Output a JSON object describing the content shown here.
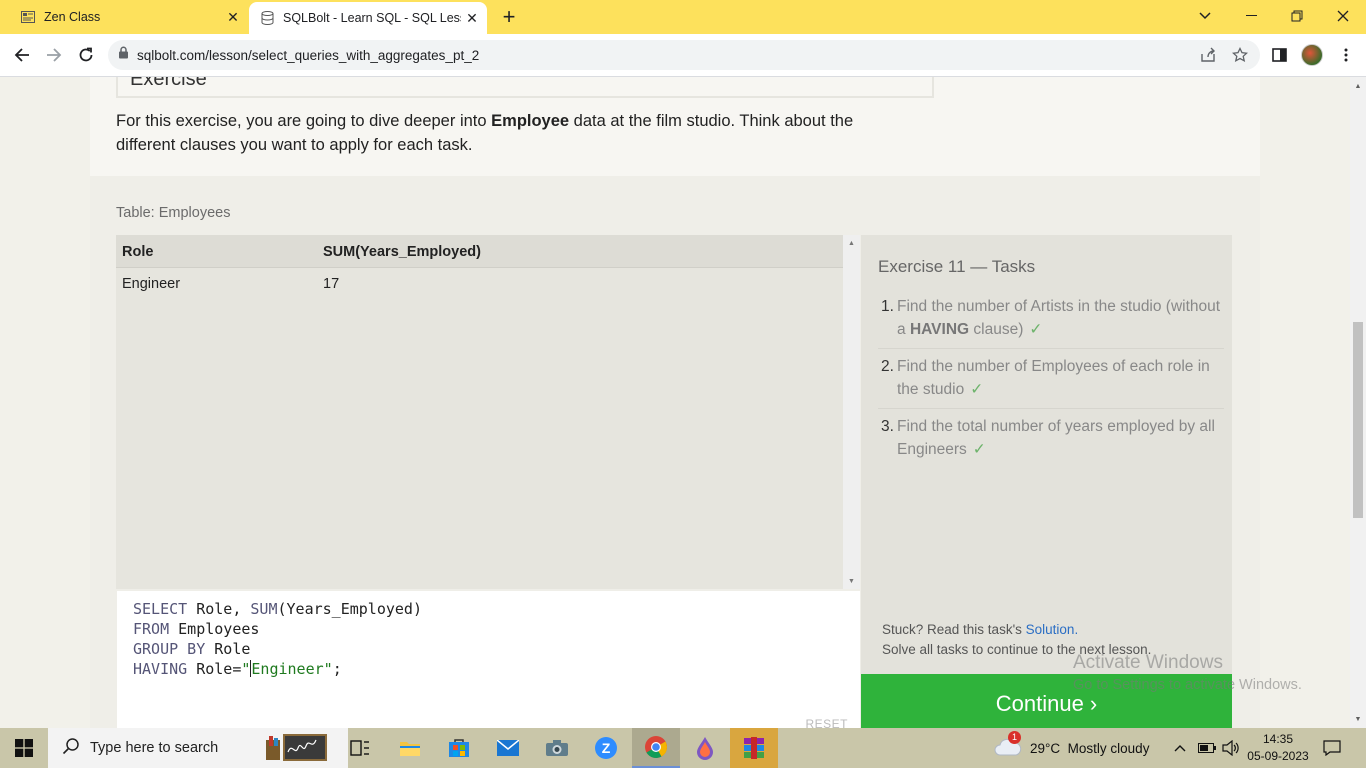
{
  "browser": {
    "tabs": [
      {
        "title": "Zen Class",
        "active": false,
        "icon": "zen-favicon"
      },
      {
        "title": "SQLBolt - Learn SQL - SQL Lesson",
        "active": true,
        "icon": "database-favicon"
      }
    ],
    "url": "sqlbolt.com/lesson/select_queries_with_aggregates_pt_2",
    "accent_color": "#fde15c"
  },
  "page": {
    "exercise_heading": "Exercise",
    "intro_before": "For this exercise, you are going to dive deeper into ",
    "intro_bold": "Employee",
    "intro_after": " data at the film studio. Think about the different clauses you want to apply for each task.",
    "table_caption": "Table: Employees",
    "results": {
      "columns": [
        "Role",
        "SUM(Years_Employed)"
      ],
      "rows": [
        [
          "Engineer",
          "17"
        ]
      ]
    },
    "query": {
      "line1_kw": "SELECT",
      "line1_rest_a": " Role, ",
      "line1_fn": "SUM",
      "line1_rest_b": "(Years_Employed)",
      "line2_kw": "FROM",
      "line2_rest": " Employees",
      "line3_kw": "GROUP BY",
      "line3_rest": " Role",
      "line4_kw": "HAVING",
      "line4_rest": " Role=",
      "line4_str_a": "\"",
      "line4_str_b": "Engineer\"",
      "line4_end": ";"
    },
    "reset_label": "RESET",
    "tasks": {
      "heading": "Exercise 11 — Tasks",
      "items": [
        {
          "num": "1.",
          "text_a": "Find the number of Artists in the studio (without a ",
          "bold": "HAVING",
          "text_b": " clause)",
          "check": "✓"
        },
        {
          "num": "2.",
          "text_a": "Find the number of Employees of each role in the studio",
          "bold": "",
          "text_b": "",
          "check": "✓"
        },
        {
          "num": "3.",
          "text_a": "Find the total number of years employed by all Engineers",
          "bold": "",
          "text_b": "",
          "check": "✓"
        }
      ]
    },
    "stuck_text": "Stuck? Read this task's ",
    "solution_link": "Solution.",
    "solve_all_text": "Solve all tasks to continue to the next lesson.",
    "continue_label": "Continue ›",
    "continue_color": "#2fb33b"
  },
  "watermark": {
    "line1": "Activate Windows",
    "line2": "Go to Settings to activate Windows."
  },
  "taskbar": {
    "search_placeholder": "Type here to search",
    "weather": "29°C  Mostly cloudy",
    "weather_badge": "1",
    "time": "14:35",
    "date": "05-09-2023"
  }
}
